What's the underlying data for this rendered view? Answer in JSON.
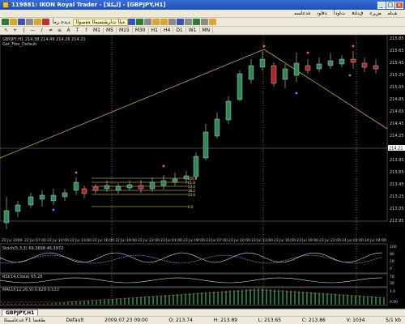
{
  "window": {
    "title": "119881: IKON Royal Trader - [ليكلا] - [GBPJPY,H1]",
    "minimize": "_",
    "restore": "□",
    "close": "x"
  },
  "menu": [
    "ﻒﻠﻣ",
    "ﺾﺮﻋ",
    "ﻕﺩﺎﻨﻓ",
    "ﺕﺍﻭﺩﺃ",
    "ﺬﻓﺍﻮﻧ",
    "ﺓﺪﻋﺎﺴﻣ"
  ],
  "toolbar": {
    "terminal_label": "ﺔﻴﻟﺁ ﺕﺍﺮﺸﺘﺴﻤﻟﺍ ﺔﻔﺻﻮﻟﺍ",
    "new_order_label": "ﺪﻳﺪﺟ ﺮﻣﺃ",
    "timeframes": [
      "M1",
      "M5",
      "M15",
      "M30",
      "H1",
      "H4",
      "D1",
      "W1",
      "MN"
    ]
  },
  "chart": {
    "symbol_line": "GBPJPY,H1 214.38 214.49 214.26 214.21",
    "sub_line": "Get_Fibo_Default",
    "price_labels": [
      "215.85",
      "215.65",
      "215.45",
      "215.25",
      "215.05",
      "214.85",
      "214.65",
      "214.45",
      "214.25",
      "214.05",
      "213.85",
      "213.65",
      "213.45",
      "213.25",
      "213.05",
      "212.95"
    ],
    "current_price": "214.21",
    "time_labels": [
      "22 Jul 2009",
      "22 Jul 07:00",
      "22 Jul 10:00",
      "22 Jul 13:00",
      "22 Jul 16:00",
      "22 Jul 19:00",
      "22 Jul 22:00",
      "23 Jul 01:00",
      "23 Jul 04:00",
      "23 Jul 07:00",
      "23 Jul 10:00",
      "23 Jul 13:00",
      "23 Jul 16:00",
      "23 Jul 19:00",
      "23 Jul 22:00",
      "24 Jul 01:00",
      "24 Jul 04:00"
    ],
    "fibo_levels": [
      "100.0",
      "61.8",
      "50.0",
      "38.2",
      "23.6",
      "0.0"
    ],
    "stoch_label": "Stoch(5,3,3) 69.3698 46.3972",
    "stoch_values": [
      "100",
      "80",
      "20",
      "0"
    ],
    "rsi_label": "RSI(14,Close) 65.26",
    "rsi_values": [
      "70",
      "30"
    ],
    "macd_label": "MACD(12,26,9) 0.829 0.533",
    "macd_values": [
      "1.0",
      "0.00"
    ]
  },
  "tabs": [
    "GBPJPY,H1"
  ],
  "status": {
    "help": "ﺓﺪﻋﺎﺴﻤﻠﻟ F1 ﻂﻐﺿﺍ",
    "profile": "Default",
    "time": "2009.07.23 09:00",
    "open": "O: 213.74",
    "high": "H: 213.89",
    "low": "L: 213.65",
    "close": "C: 213.86",
    "volume": "V: 1034",
    "traffic": "5/1 kb"
  },
  "colors": {
    "bull": "#2e8b57",
    "bear": "#b22222",
    "trend": "#c8a83a",
    "fibo": "#f0e060",
    "grid": "#555555"
  }
}
